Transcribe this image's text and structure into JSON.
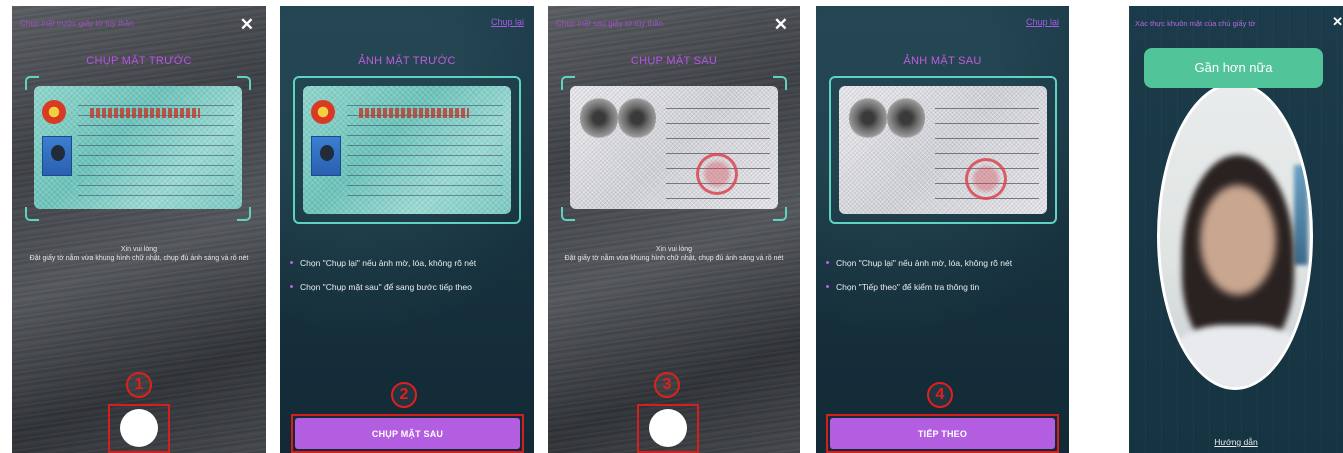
{
  "screens": [
    {
      "header": "Chụp mặt trước giấy tờ tùy thân",
      "title": "CHỤP MẶT TRƯỚC",
      "instruction": "Xin vui lòng\nĐặt giấy tờ nằm vừa khung hình chữ nhật, chụp đủ ánh sáng và rõ nét",
      "step": "1",
      "shutter_icon": "shutter-circle"
    },
    {
      "retake": "Chụp lại",
      "title": "ẢNH MẶT TRƯỚC",
      "bullets": [
        "Chọn \"Chụp lại\" nếu ảnh mờ, lóa, không rõ nét",
        "Chọn \"Chụp mặt sau\" để sang bước tiếp theo"
      ],
      "step": "2",
      "button": "CHỤP MẶT SAU"
    },
    {
      "header": "Chụp mặt sau giấy tờ tùy thân",
      "title": "CHỤP MẶT SAU",
      "instruction": "Xin vui lòng\nĐặt giấy tờ nằm vừa khung hình chữ nhật, chụp đủ ánh sáng và rõ nét",
      "step": "3",
      "shutter_icon": "shutter-circle"
    },
    {
      "retake": "Chụp lại",
      "title": "ẢNH MẶT SAU",
      "bullets": [
        "Chọn \"Chụp lại\" nếu ảnh mờ, lóa, không rõ nét",
        "Chọn \"Tiếp theo\" để kiểm tra thông tin"
      ],
      "step": "4",
      "button": "TIẾP THEO"
    },
    {
      "header": "Xác thực khuôn mặt của chủ giấy tờ",
      "prompt": "Gần hơn nữa",
      "guide": "Hướng dẫn"
    }
  ],
  "icons": {
    "close": "close-icon",
    "shutter": "shutter-button"
  },
  "colors": {
    "accent_purple": "#b35de0",
    "frame_teal": "#5fd3c2",
    "prompt_green": "#52c49a",
    "highlight_red": "#d4201c"
  }
}
